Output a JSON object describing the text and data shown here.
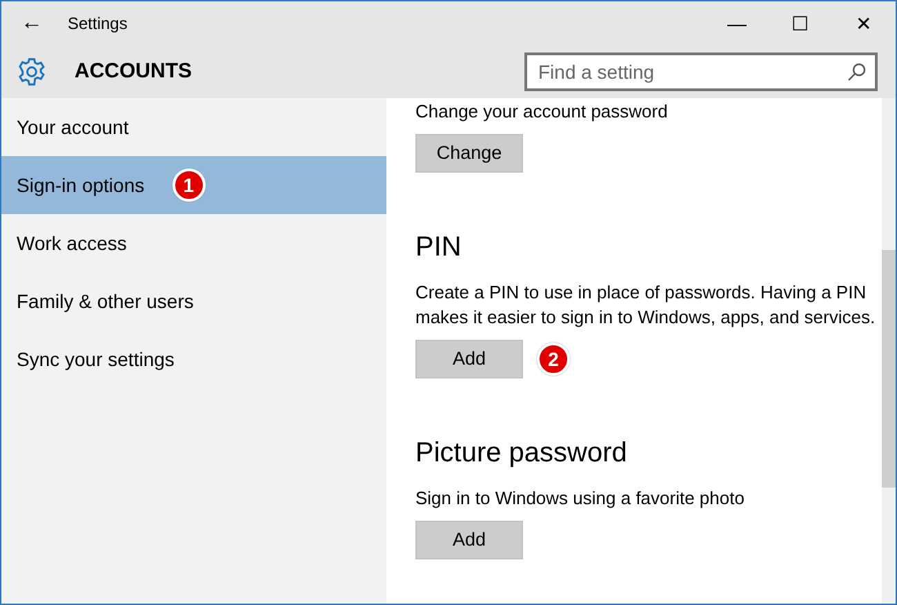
{
  "window": {
    "title": "Settings",
    "back": "←",
    "controls": [
      "—",
      "☐",
      "✕"
    ]
  },
  "header": {
    "title": "ACCOUNTS",
    "search": {
      "placeholder": "Find a setting"
    }
  },
  "sidebar": {
    "items": [
      {
        "label": "Your account",
        "selected": false
      },
      {
        "label": "Sign-in options",
        "selected": true,
        "callout": "1"
      },
      {
        "label": "Work access",
        "selected": false
      },
      {
        "label": "Family & other users",
        "selected": false
      },
      {
        "label": "Sync your settings",
        "selected": false
      }
    ]
  },
  "content": {
    "sections": [
      {
        "kind": "partial",
        "description": "Change your account password",
        "button": "Change"
      },
      {
        "kind": "section",
        "heading": "PIN",
        "description": "Create a PIN to use in place of passwords. Having a PIN makes it easier to sign in to Windows, apps, and services.",
        "button": "Add",
        "callout": "2"
      },
      {
        "kind": "section",
        "heading": "Picture password",
        "description": "Sign in to Windows using a favorite photo",
        "button": "Add"
      }
    ]
  }
}
